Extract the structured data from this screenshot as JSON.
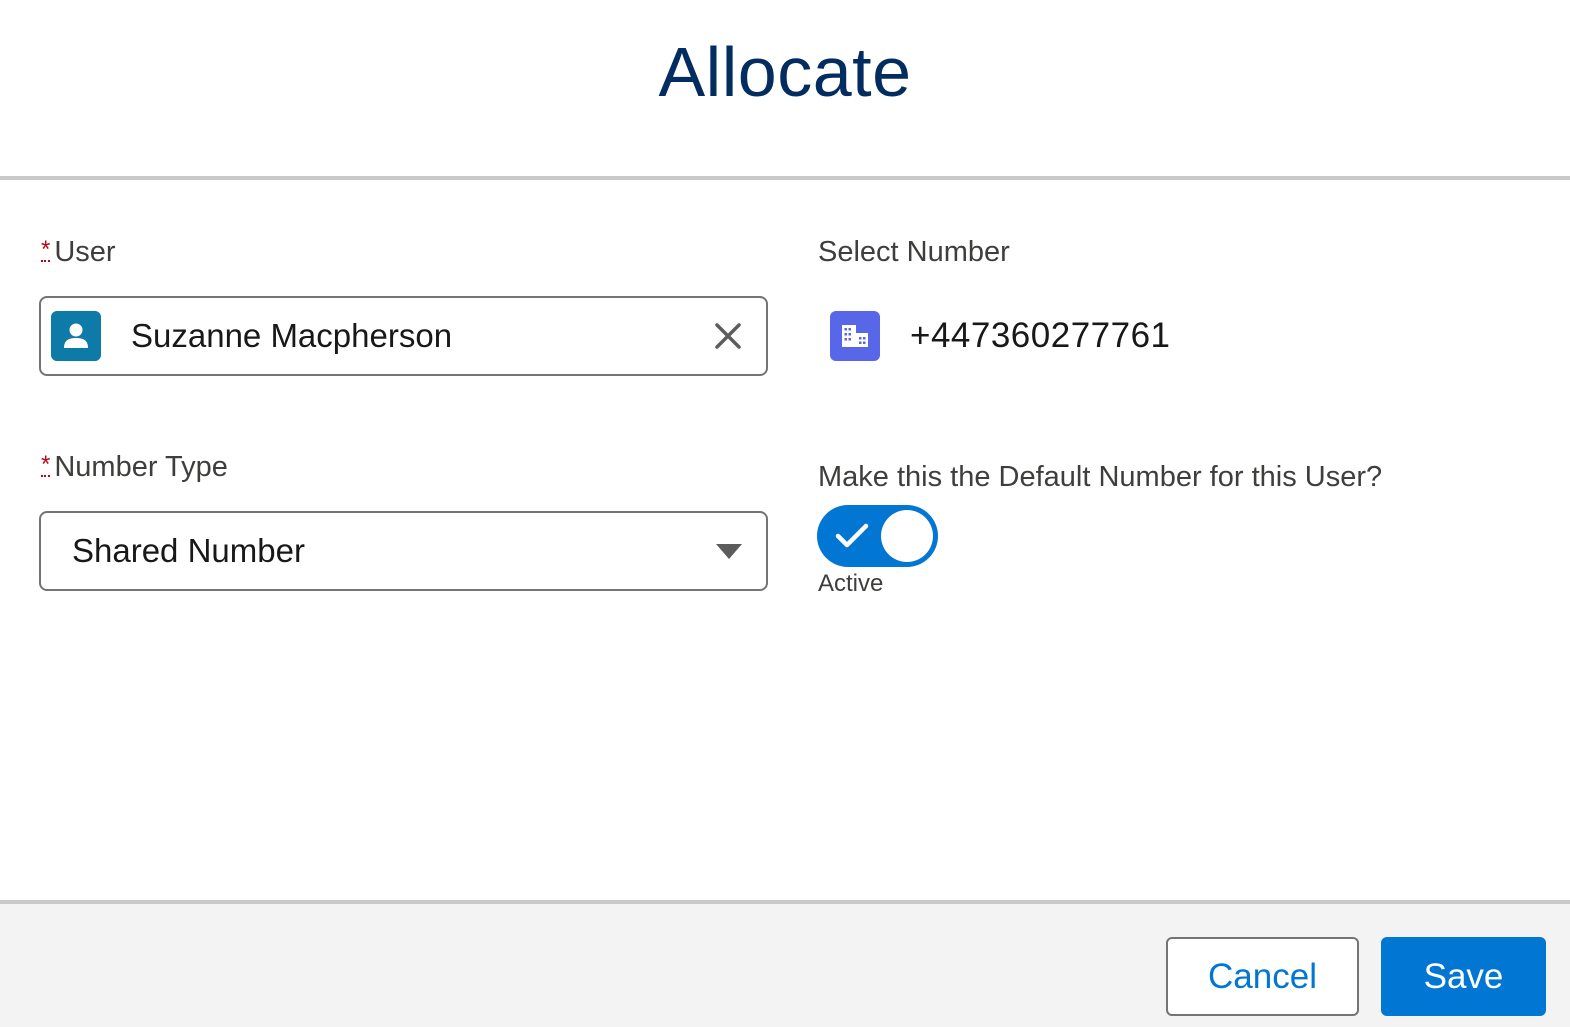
{
  "header": {
    "title": "Allocate"
  },
  "form": {
    "user": {
      "required_mark": "*",
      "label": "User",
      "value": "Suzanne Macpherson",
      "avatar_icon": "user-icon",
      "clear_icon": "close-icon"
    },
    "select_number": {
      "label": "Select Number",
      "value": "+447360277761",
      "icon": "building-icon"
    },
    "number_type": {
      "required_mark": "*",
      "label": "Number Type",
      "value": "Shared Number",
      "caret_icon": "caret-down-icon"
    },
    "default_number": {
      "label": "Make this the Default Number for this User?",
      "checked": true,
      "status": "Active"
    }
  },
  "footer": {
    "cancel_label": "Cancel",
    "save_label": "Save"
  },
  "colors": {
    "brand": "#0176d3",
    "title": "#032d60",
    "required": "#ba0517",
    "user_avatar": "#0d7aa8",
    "number_icon": "#5867e8"
  }
}
